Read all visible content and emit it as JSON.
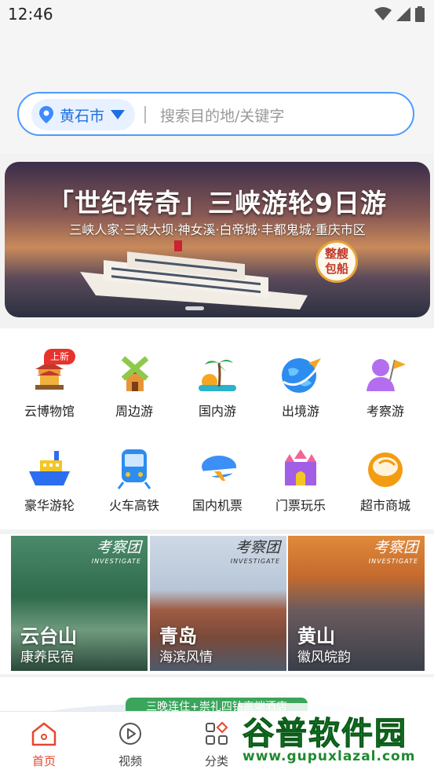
{
  "status_bar": {
    "time": "12:46",
    "wifi_icon": "wifi-icon",
    "signal_icon": "signal-icon",
    "battery_icon": "battery-icon"
  },
  "search": {
    "city": "黄石市",
    "placeholder": "搜索目的地/关键字"
  },
  "banner": {
    "title": "「世纪传奇」三峡游轮9日游",
    "subtitle": "三峡人家·三峡大坝·神女溪·白帝城·丰都鬼城·重庆市区",
    "badge_line1": "整艘",
    "badge_line2": "包船"
  },
  "categories": [
    {
      "label": "云博物馆",
      "icon": "museum-icon",
      "badge": "上新"
    },
    {
      "label": "周边游",
      "icon": "windmill-icon"
    },
    {
      "label": "国内游",
      "icon": "palm-tree-icon"
    },
    {
      "label": "出境游",
      "icon": "globe-plane-icon"
    },
    {
      "label": "考察游",
      "icon": "person-flag-icon"
    },
    {
      "label": "豪华游轮",
      "icon": "cruise-ship-icon"
    },
    {
      "label": "火车高铁",
      "icon": "train-icon"
    },
    {
      "label": "国内机票",
      "icon": "airplane-icon"
    },
    {
      "label": "门票玩乐",
      "icon": "castle-icon"
    },
    {
      "label": "超市商城",
      "icon": "coconut-icon"
    }
  ],
  "destinations": [
    {
      "tag": "考察团",
      "tag_sub": "INVESTIGATE",
      "title": "云台山",
      "subtitle": "康养民宿"
    },
    {
      "tag": "考察团",
      "tag_sub": "INVESTIGATE",
      "title": "青岛",
      "subtitle": "海滨风情"
    },
    {
      "tag": "考察团",
      "tag_sub": "INVESTIGATE",
      "title": "黄山",
      "subtitle": "徽风皖韵"
    }
  ],
  "promo": {
    "text": "三晚连住+崇礼四钻高端酒店"
  },
  "tabs": [
    {
      "label": "首页",
      "icon": "home-icon",
      "active": true
    },
    {
      "label": "视频",
      "icon": "play-icon",
      "active": false
    },
    {
      "label": "分类",
      "icon": "category-grid-icon",
      "active": false
    }
  ],
  "watermark": {
    "name": "谷普软件园",
    "url": "www.gupuxlazal.com"
  },
  "colors": {
    "accent": "#4d9bff",
    "active_tab": "#e8452f",
    "new_badge": "#e8322c"
  }
}
